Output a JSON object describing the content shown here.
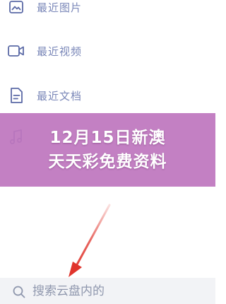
{
  "menu": {
    "items": [
      {
        "label": "最近图片",
        "icon": "image-icon"
      },
      {
        "label": "最近视频",
        "icon": "video-icon"
      },
      {
        "label": "最近文档",
        "icon": "document-icon"
      },
      {
        "label": "",
        "icon": "music-icon"
      }
    ]
  },
  "overlay": {
    "line1": "12月15日新澳",
    "line2": "天天彩免费资料"
  },
  "search": {
    "placeholder": "搜索云盘内的"
  },
  "colors": {
    "menu_text": "#7a87b8",
    "icon_stroke": "#5b6aa6",
    "overlay": "#be76be",
    "arrow": "#e0342c",
    "search_bg": "#f2f3f6"
  }
}
